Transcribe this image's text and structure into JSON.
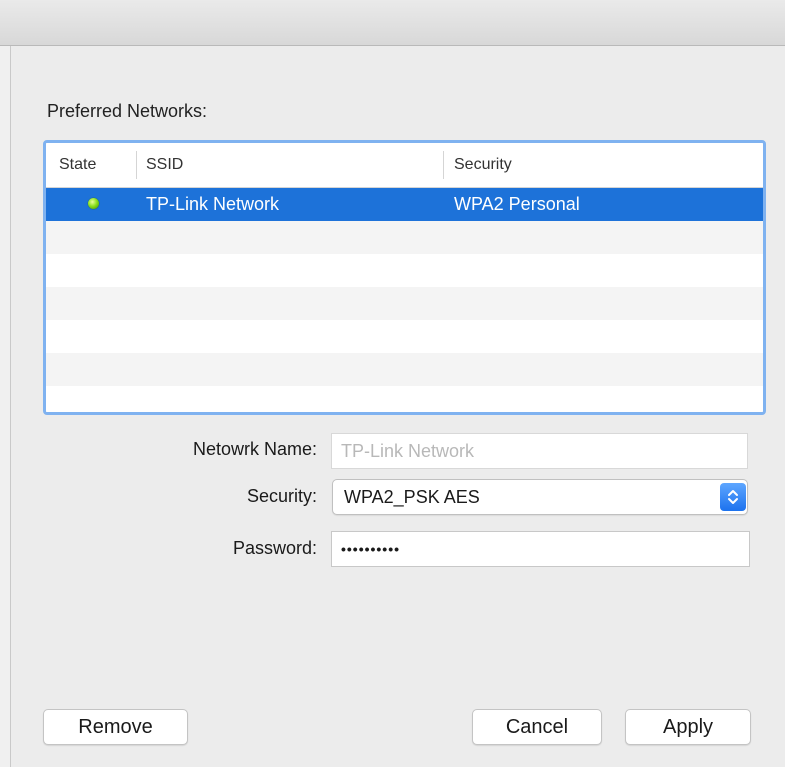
{
  "section": {
    "title": "Preferred Networks:"
  },
  "table": {
    "columns": [
      "State",
      "SSID",
      "Security"
    ],
    "rows": [
      {
        "state": "connected",
        "ssid": "TP-Link Network",
        "security": "WPA2 Personal"
      }
    ]
  },
  "form": {
    "network_name": {
      "label": "Netowrk Name:",
      "value": "TP-Link Network"
    },
    "security": {
      "label": "Security:",
      "value": "WPA2_PSK AES"
    },
    "password": {
      "label": "Password:",
      "value": "••••••••••"
    }
  },
  "buttons": {
    "remove": "Remove",
    "cancel": "Cancel",
    "apply": "Apply"
  },
  "colors": {
    "selection": "#1d72d9",
    "focus_ring": "#7fb2f0",
    "status_led": "#8ce11f",
    "select_arrow": "#1c72ee"
  },
  "icons": {
    "state": "green-status-led",
    "select": "up-down-chevrons"
  }
}
